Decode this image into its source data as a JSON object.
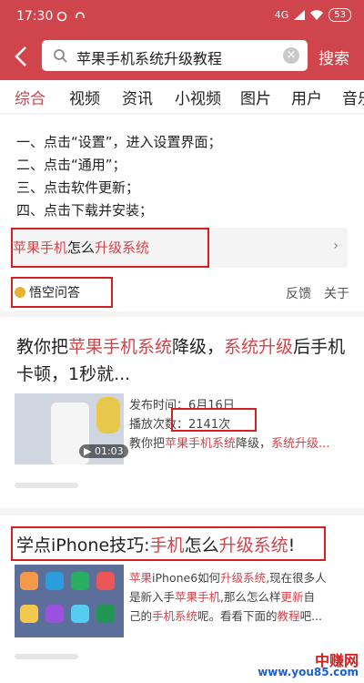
{
  "status_bar": {
    "time": "17:30",
    "battery": "53",
    "signal": "4G"
  },
  "search": {
    "query": "苹果手机系统升级教程",
    "button_label": "搜索"
  },
  "tabs": [
    "综合",
    "视频",
    "资讯",
    "小视频",
    "图片",
    "用户",
    "音乐"
  ],
  "active_tab": 0,
  "answer_card": {
    "steps": [
      "一、点击“设置”，进入设置界面；",
      "二、点击“通用”；",
      "三、点击软件更新；",
      "四、点击下载并安装；"
    ],
    "related": {
      "red": "苹果手机",
      "plain": "怎么",
      "red2": "升级系统"
    },
    "source": "悟空问答",
    "feedback": "反馈",
    "about": "关于"
  },
  "video_card": {
    "title_parts": [
      "教你把",
      "苹果手机系统",
      "降级，",
      "系统升级",
      "后手机"
    ],
    "title_line2": "卡顿，1秒就...",
    "publish": "发布时间：6月16日",
    "plays": "播放次数：2141次",
    "desc": [
      "教你把",
      "苹果手机系统",
      "降级，",
      "系统升级..."
    ],
    "duration": "01:03"
  },
  "article_card": {
    "title_parts": [
      "学点iPhone技巧:",
      "手机",
      "怎么",
      "升级系统",
      "!"
    ],
    "snippet_lines": [
      [
        "苹果",
        "iPhone6如何",
        "升级系统",
        ",现在很多人"
      ],
      [
        "是新入手",
        "苹果手机",
        ",那么怎么样",
        "更新",
        "自"
      ],
      [
        "己的",
        "手机系统",
        "呢。看看下面的",
        "教程",
        "吧..."
      ]
    ]
  },
  "watermark": {
    "name": "中赚网",
    "url": "www.you85.com"
  },
  "colors": {
    "brand_red": "#d0454c",
    "annotation_box": "#d42020"
  }
}
